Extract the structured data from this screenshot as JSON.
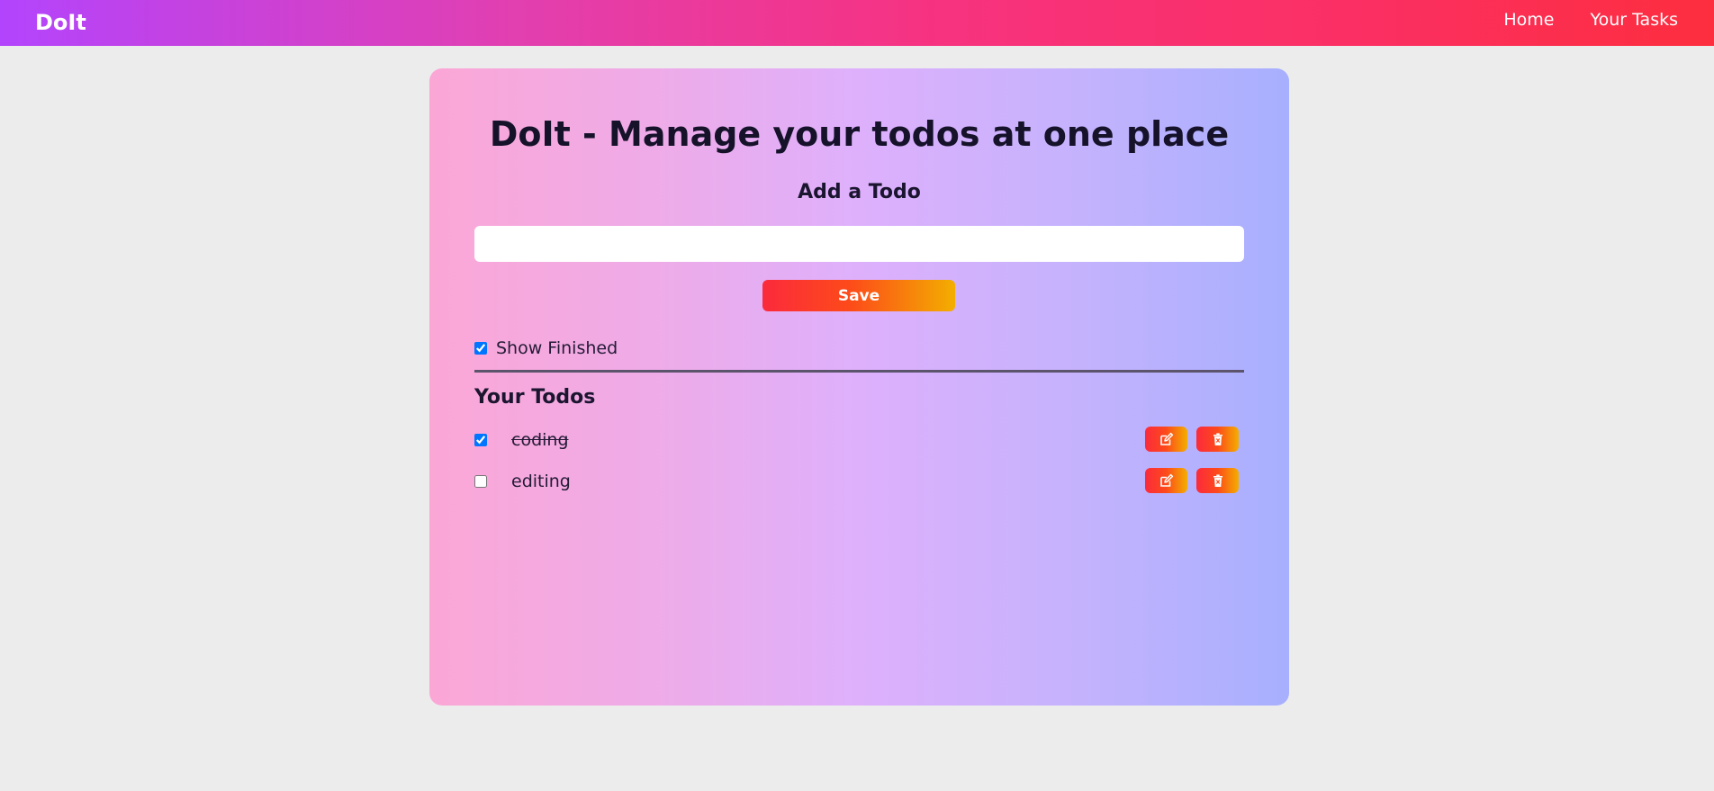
{
  "navbar": {
    "brand": "DoIt",
    "links": [
      "Home",
      "Your Tasks"
    ]
  },
  "main": {
    "title": "DoIt - Manage your todos at one place",
    "add_heading": "Add a Todo",
    "input_value": "",
    "save_label": "Save",
    "show_finished_label": "Show Finished",
    "show_finished_checked": true,
    "todos_heading": "Your Todos",
    "todos": [
      {
        "text": "coding",
        "completed": true,
        "edit_icon": "edit-icon",
        "delete_icon": "trash-icon"
      },
      {
        "text": "editing",
        "completed": false,
        "edit_icon": "edit-icon",
        "delete_icon": "trash-icon"
      }
    ]
  },
  "colors": {
    "navbar_gradient_start": "#b344fd",
    "navbar_gradient_end": "#fd2e3e",
    "card_gradient_start": "#fba7d6",
    "card_gradient_end": "#a7b0fe",
    "button_gradient_start": "#fb2a3c",
    "button_gradient_end": "#f3ae00",
    "page_background": "#ececec"
  }
}
